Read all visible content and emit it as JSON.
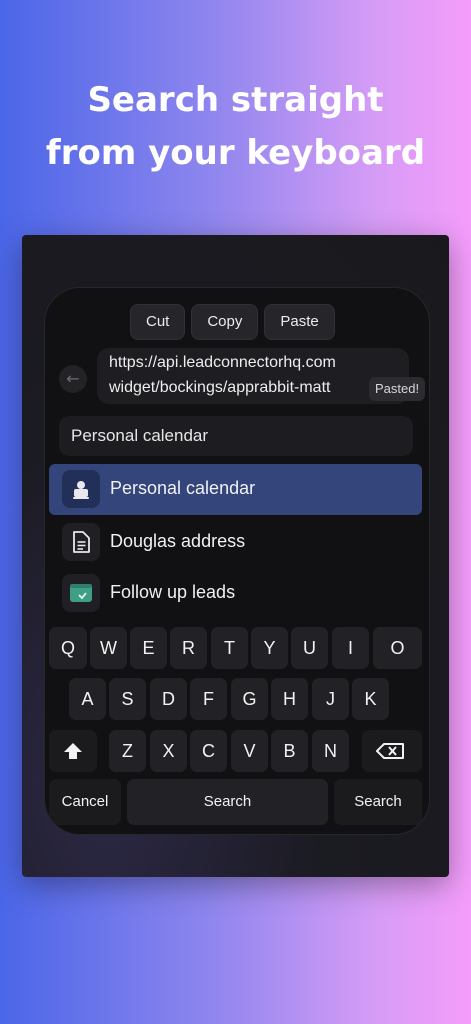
{
  "headline": {
    "line1": "Search straight",
    "line2": "from your keyboard"
  },
  "edit_menu": [
    "Cut",
    "Copy",
    "Paste"
  ],
  "url_field": {
    "line1": "https://api.leadconnectorhq.com",
    "line2": "widget/bockings/apprabbit-matt"
  },
  "pasted_badge": "Pasted!",
  "search": {
    "value": "Personal calendar"
  },
  "results": [
    {
      "label": "Personal calendar",
      "icon": "calendar-person-icon",
      "selected": true
    },
    {
      "label": "Douglas address",
      "icon": "document-icon",
      "selected": false
    },
    {
      "label": "Follow up leads",
      "icon": "window-check-icon",
      "selected": false
    }
  ],
  "keyboard": {
    "row1": [
      "Q",
      "W",
      "E",
      "R",
      "T",
      "Y",
      "U",
      "I",
      "O"
    ],
    "row2": [
      "A",
      "S",
      "D",
      "F",
      "G",
      "H",
      "J",
      "K"
    ],
    "row3": [
      "Z",
      "X",
      "C",
      "V",
      "B",
      "N"
    ],
    "shift": "shift-icon",
    "backspace": "backspace-icon",
    "cancel": "Cancel",
    "space": "Search",
    "return": "Search"
  },
  "colors": {
    "accent_selected": "#34457b",
    "background_left": "#4a66e8",
    "background_right": "#f59dfb"
  }
}
